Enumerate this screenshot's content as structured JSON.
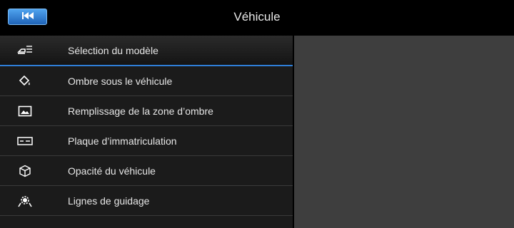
{
  "header": {
    "title": "Véhicule",
    "back_icon": "skip-back-icon"
  },
  "menu": {
    "items": [
      {
        "label": "Sélection du modèle",
        "icon": "car-model-icon",
        "selected": true
      },
      {
        "label": "Ombre sous le véhicule",
        "icon": "paint-bucket-icon",
        "selected": false
      },
      {
        "label": "Remplissage de la zone d’ombre",
        "icon": "image-fill-icon",
        "selected": false
      },
      {
        "label": "Plaque d’immatriculation",
        "icon": "license-plate-icon",
        "selected": false
      },
      {
        "label": "Opacité du véhicule",
        "icon": "cube-icon",
        "selected": false
      },
      {
        "label": "Lignes de guidage",
        "icon": "guide-lines-icon",
        "selected": false
      }
    ]
  },
  "colors": {
    "accent": "#2f7fd8",
    "button": "#3a8be0",
    "menu_bg": "#1b1b1b",
    "detail_bg": "#3e3e3e"
  }
}
